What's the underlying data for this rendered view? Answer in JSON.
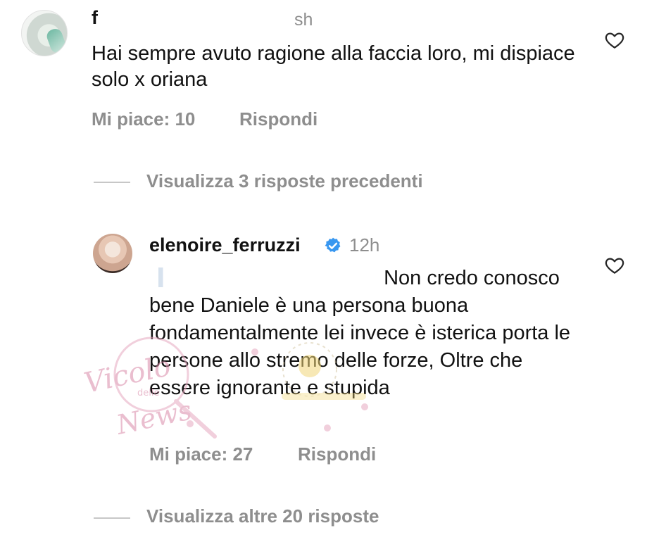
{
  "comment": {
    "username": "f",
    "time": "sh",
    "text": "Hai sempre avuto ragione alla faccia loro, mi dispiace solo x oriana",
    "likes_label": "Mi piace: 10",
    "reply_label": "Rispondi",
    "like_icon": "heart-outline-icon"
  },
  "previous_replies_label": "Visualizza 3 risposte precedenti",
  "reply": {
    "username": "elenoire_ferruzzi",
    "verified_icon": "verified-badge-icon",
    "time": "12h",
    "text": "Non credo conosco bene Daniele è una persona buona fondamentalmente lei invece è isterica porta le persone allo stremo delle forze, Oltre che essere ignorante e stupida",
    "likes_label": "Mi piace: 27",
    "reply_label": "Rispondi",
    "like_icon": "heart-outline-icon"
  },
  "more_replies_label": "Visualizza altre 20 risposte",
  "watermark": {
    "line1": "Vicolo",
    "line2": "delle",
    "line3": "News"
  },
  "colors": {
    "text": "#111111",
    "secondary": "#8e8e8e",
    "verified": "#3897f0",
    "divider": "#c7c7c7",
    "watermark": "#d98aa8"
  }
}
